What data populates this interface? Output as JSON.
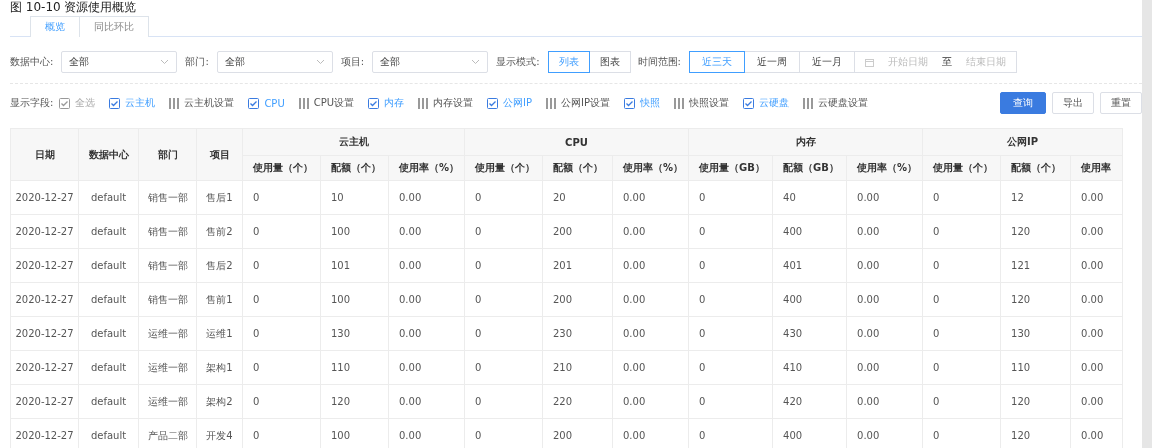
{
  "caption": "图 10-10 资源使用概览",
  "tabs": [
    {
      "label": "概览",
      "selected": true
    },
    {
      "label": "同比环比",
      "selected": false
    }
  ],
  "selects": [
    {
      "label": "数据中心:",
      "value": "全部"
    },
    {
      "label": "部门:",
      "value": "全部"
    },
    {
      "label": "项目:",
      "value": "全部"
    }
  ],
  "display_mode": {
    "label": "显示模式:",
    "options": [
      {
        "label": "列表",
        "selected": true
      },
      {
        "label": "图表",
        "selected": false
      }
    ]
  },
  "time_range": {
    "label": "时间范围:",
    "options": [
      {
        "label": "近三天",
        "selected": true
      },
      {
        "label": "近一周",
        "selected": false
      },
      {
        "label": "近一月",
        "selected": false
      }
    ],
    "start_placeholder": "开始日期",
    "separator": "至",
    "end_placeholder": "结束日期"
  },
  "fields": {
    "label": "显示字段:",
    "items": [
      {
        "kind": "checkbox",
        "label": "全选",
        "checked": true,
        "disabled": true
      },
      {
        "kind": "checkbox",
        "label": "云主机",
        "checked": true,
        "disabled": false
      },
      {
        "kind": "setting",
        "label": "云主机设置"
      },
      {
        "kind": "checkbox",
        "label": "CPU",
        "checked": true,
        "disabled": false
      },
      {
        "kind": "setting",
        "label": "CPU设置"
      },
      {
        "kind": "checkbox",
        "label": "内存",
        "checked": true,
        "disabled": false
      },
      {
        "kind": "setting",
        "label": "内存设置"
      },
      {
        "kind": "checkbox",
        "label": "公网IP",
        "checked": true,
        "disabled": false
      },
      {
        "kind": "setting",
        "label": "公网IP设置"
      },
      {
        "kind": "checkbox",
        "label": "快照",
        "checked": true,
        "disabled": false
      },
      {
        "kind": "setting",
        "label": "快照设置"
      },
      {
        "kind": "checkbox",
        "label": "云硬盘",
        "checked": true,
        "disabled": false
      },
      {
        "kind": "setting",
        "label": "云硬盘设置"
      }
    ]
  },
  "buttons": [
    {
      "label": "查询",
      "primary": true
    },
    {
      "label": "导出",
      "primary": false
    },
    {
      "label": "重置",
      "primary": false
    }
  ],
  "table": {
    "columns": [
      "日期",
      "数据中心",
      "部门",
      "项目"
    ],
    "groups": [
      {
        "title": "云主机",
        "columns": [
          "使用量（个）",
          "配额（个）",
          "使用率（%）"
        ]
      },
      {
        "title": "CPU",
        "columns": [
          "使用量（个）",
          "配额（个）",
          "使用率（%）"
        ]
      },
      {
        "title": "内存",
        "columns": [
          "使用量（GB）",
          "配额（GB）",
          "使用率（%）"
        ]
      },
      {
        "title": "公网IP",
        "columns": [
          "使用量（个）",
          "配额（个）",
          "使用率"
        ]
      }
    ],
    "rows": [
      [
        "2020-12-27",
        "default",
        "销售一部",
        "售后1",
        "0",
        "10",
        "0.00",
        "0",
        "20",
        "0.00",
        "0",
        "40",
        "0.00",
        "0",
        "12",
        "0.00"
      ],
      [
        "2020-12-27",
        "default",
        "销售一部",
        "售前2",
        "0",
        "100",
        "0.00",
        "0",
        "200",
        "0.00",
        "0",
        "400",
        "0.00",
        "0",
        "120",
        "0.00"
      ],
      [
        "2020-12-27",
        "default",
        "销售一部",
        "售后2",
        "0",
        "101",
        "0.00",
        "0",
        "201",
        "0.00",
        "0",
        "401",
        "0.00",
        "0",
        "121",
        "0.00"
      ],
      [
        "2020-12-27",
        "default",
        "销售一部",
        "售前1",
        "0",
        "100",
        "0.00",
        "0",
        "200",
        "0.00",
        "0",
        "400",
        "0.00",
        "0",
        "120",
        "0.00"
      ],
      [
        "2020-12-27",
        "default",
        "运维一部",
        "运维1",
        "0",
        "130",
        "0.00",
        "0",
        "230",
        "0.00",
        "0",
        "430",
        "0.00",
        "0",
        "130",
        "0.00"
      ],
      [
        "2020-12-27",
        "default",
        "运维一部",
        "架构1",
        "0",
        "110",
        "0.00",
        "0",
        "210",
        "0.00",
        "0",
        "410",
        "0.00",
        "0",
        "110",
        "0.00"
      ],
      [
        "2020-12-27",
        "default",
        "运维一部",
        "架构2",
        "0",
        "120",
        "0.00",
        "0",
        "220",
        "0.00",
        "0",
        "420",
        "0.00",
        "0",
        "120",
        "0.00"
      ],
      [
        "2020-12-27",
        "default",
        "产品二部",
        "开发4",
        "0",
        "100",
        "0.00",
        "0",
        "200",
        "0.00",
        "0",
        "400",
        "0.00",
        "0",
        "120",
        "0.00"
      ]
    ]
  }
}
